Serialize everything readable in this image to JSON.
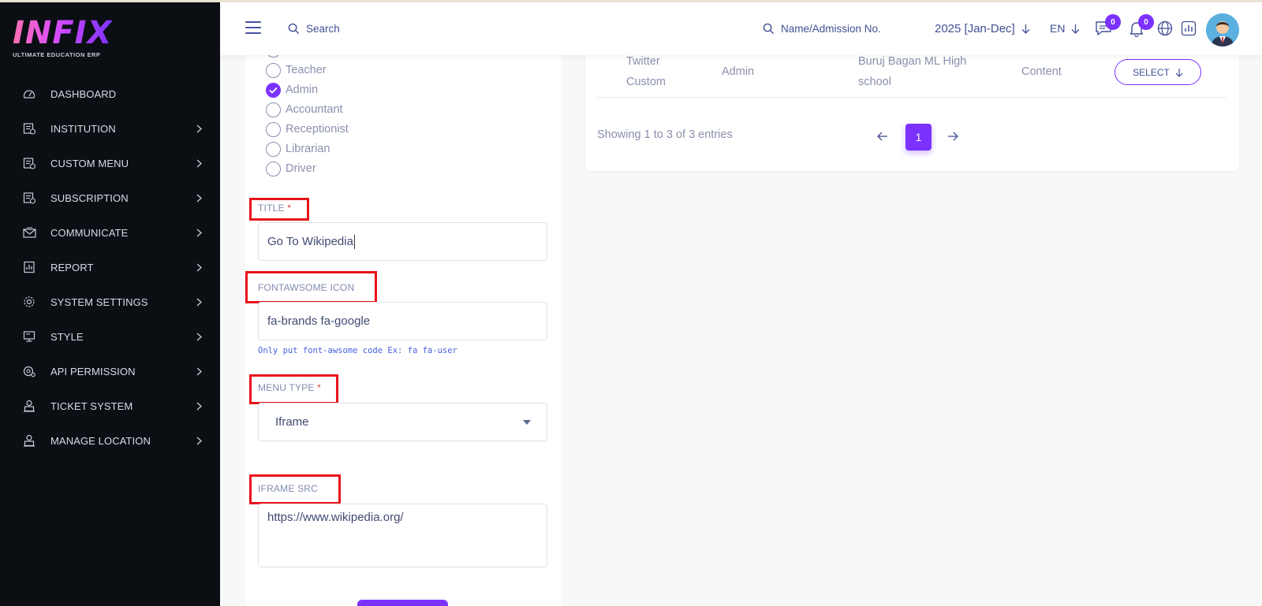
{
  "brand": {
    "logo_text": "INFIX",
    "tagline": "ULTIMATE EDUCATION ERP",
    "accent": "#7c32ff"
  },
  "sidebar": {
    "items": [
      {
        "label": "DASHBOARD",
        "icon": "speedometer-icon",
        "has_submenu": false
      },
      {
        "label": "INSTITUTION",
        "icon": "institution-icon",
        "has_submenu": true
      },
      {
        "label": "CUSTOM MENU",
        "icon": "custom-menu-icon",
        "has_submenu": true
      },
      {
        "label": "SUBSCRIPTION",
        "icon": "subscription-icon",
        "has_submenu": true
      },
      {
        "label": "COMMUNICATE",
        "icon": "envelope-icon",
        "has_submenu": true
      },
      {
        "label": "REPORT",
        "icon": "report-icon",
        "has_submenu": true
      },
      {
        "label": "SYSTEM SETTINGS",
        "icon": "gear-icon",
        "has_submenu": true
      },
      {
        "label": "STYLE",
        "icon": "monitor-icon",
        "has_submenu": true
      },
      {
        "label": "API PERMISSION",
        "icon": "api-icon",
        "has_submenu": true
      },
      {
        "label": "TICKET SYSTEM",
        "icon": "ticket-icon",
        "has_submenu": true
      },
      {
        "label": "MANAGE LOCATION",
        "icon": "location-icon",
        "has_submenu": true
      }
    ]
  },
  "header": {
    "search_label": "Search",
    "student_search_label": "Name/Admission No.",
    "academic_year": "2025 [Jan-Dec]",
    "language": "EN",
    "message_count": "0",
    "notification_count": "0"
  },
  "form": {
    "roles": [
      {
        "label": "Teacher",
        "checked": false
      },
      {
        "label": "Admin",
        "checked": true
      },
      {
        "label": "Accountant",
        "checked": false
      },
      {
        "label": "Receptionist",
        "checked": false
      },
      {
        "label": "Librarian",
        "checked": false
      },
      {
        "label": "Driver",
        "checked": false
      }
    ],
    "title_label": "TITLE",
    "title_required": "*",
    "title_value": "Go To Wikipedia",
    "icon_label": "FONTAWSOME ICON",
    "icon_value": "fa-brands fa-google",
    "icon_hint": "Only put font-awsome code Ex: fa fa-user",
    "menu_type_label": "MENU TYPE",
    "menu_type_required": "*",
    "menu_type_value": "Iframe",
    "iframe_label": "IFRAME SRC",
    "iframe_value": "https://www.wikipedia.org/"
  },
  "table": {
    "row": {
      "title_line1": "Twitter",
      "title_line2": "Custom",
      "role": "Admin",
      "school_line1": "Buruj Bagan ML High",
      "school_line2": "school",
      "type": "Content",
      "action": "SELECT"
    },
    "showing": "Showing 1 to 3 of 3 entries",
    "current_page": "1"
  }
}
